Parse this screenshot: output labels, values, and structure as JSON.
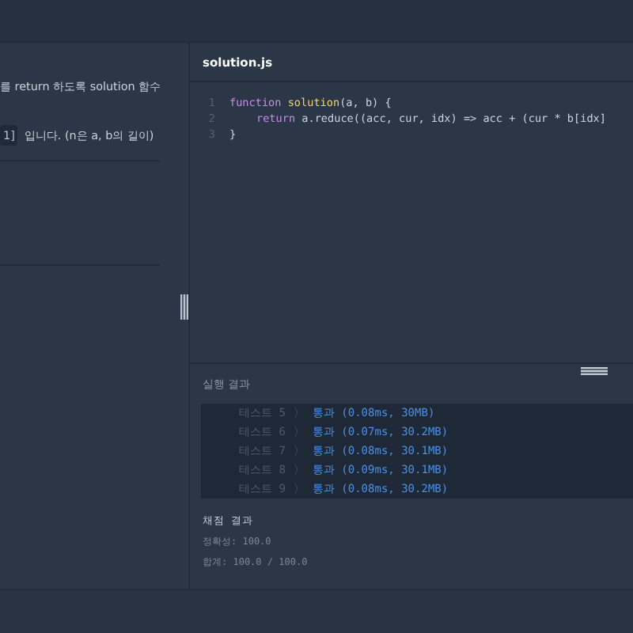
{
  "problem": {
    "lines": [
      {
        "text": "를 return 하도록 solution 함수"
      },
      {
        "code": "1]",
        "text": "입니다. (n은 a, b의 길이)"
      }
    ]
  },
  "editor": {
    "filename": "solution.js",
    "lines": [
      {
        "number": "1",
        "indented": false,
        "tokens": [
          {
            "kind": "keyword",
            "text": "function"
          },
          {
            "kind": "function",
            "text": "solution"
          },
          {
            "kind": "plain",
            "text": "(a, b) {"
          }
        ]
      },
      {
        "number": "2",
        "indented": true,
        "tokens": [
          {
            "kind": "keyword",
            "text": "return"
          },
          {
            "kind": "plain",
            "text": "a.reduce((acc, cur, idx) => acc + (cur * b[idx]"
          }
        ]
      },
      {
        "number": "3",
        "indented": false,
        "tokens": [
          {
            "kind": "plain",
            "text": "}"
          }
        ]
      }
    ]
  },
  "results": {
    "title": "실행 결과",
    "tests": [
      {
        "label": "테스트 5",
        "separator": "〉",
        "result": "통과 (0.08ms, 30MB)"
      },
      {
        "label": "테스트 6",
        "separator": "〉",
        "result": "통과 (0.07ms, 30.2MB)"
      },
      {
        "label": "테스트 7",
        "separator": "〉",
        "result": "통과 (0.08ms, 30.1MB)"
      },
      {
        "label": "테스트 8",
        "separator": "〉",
        "result": "통과 (0.09ms, 30.1MB)"
      },
      {
        "label": "테스트 9",
        "separator": "〉",
        "result": "통과 (0.08ms, 30.2MB)"
      }
    ],
    "grading": {
      "title": "채점 결과",
      "lines": [
        "정확성: 100.0",
        "합계: 100.0 / 100.0"
      ]
    }
  }
}
